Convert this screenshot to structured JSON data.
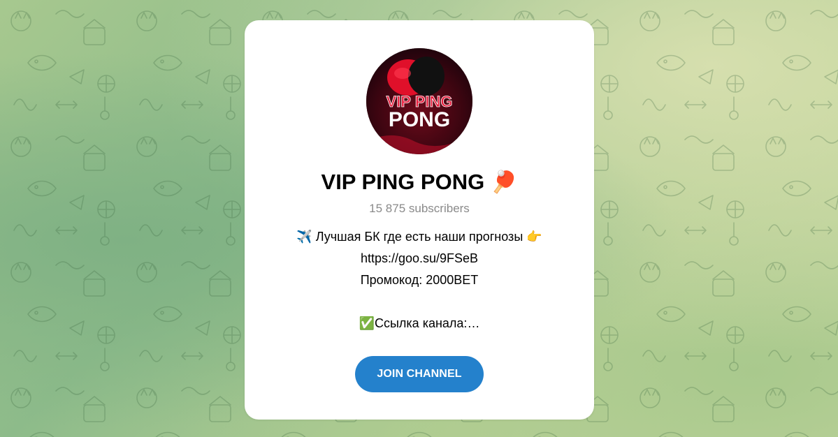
{
  "channel": {
    "title": "VIP PING PONG",
    "title_emoji": "🏓",
    "subscribers": "15 875 subscribers",
    "avatar_text_top": "VIP PING",
    "avatar_text_bottom": "PONG"
  },
  "description": {
    "line1_emoji_start": "✈️",
    "line1_text": "Лучшая БК где есть наши прогнозы",
    "line1_emoji_end": "👉",
    "line2": "https://goo.su/9FSeB",
    "line3": "Промокод: 2000BET",
    "line5_emoji": "✅",
    "line5_text": "Ссылка канала:…"
  },
  "join_button": {
    "label": "JOIN CHANNEL"
  },
  "colors": {
    "button": "#2481cc",
    "background_green": "#8dbb8a",
    "card": "#ffffff"
  }
}
